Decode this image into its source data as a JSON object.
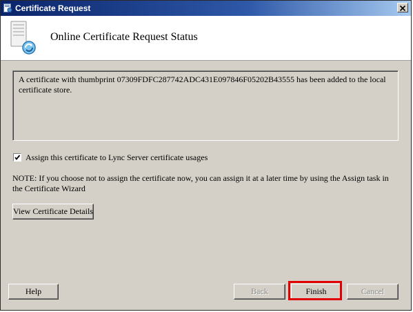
{
  "window": {
    "title": "Certificate Request",
    "icons": {
      "title": "certificate-icon",
      "close": "close-icon"
    }
  },
  "header": {
    "title": "Online Certificate Request Status",
    "icon": "server-certificate-icon"
  },
  "status": {
    "message": "A certificate with thumbprint 07309FDFC287742ADC431E097846F05202B43555 has been added to the local certificate store."
  },
  "assign_option": {
    "label": "Assign this certificate to Lync Server certificate usages",
    "checked": true
  },
  "note": "NOTE: If you choose not to assign the certificate now, you can assign it at a later time by using the Assign task in the Certificate Wizard",
  "buttons": {
    "view_details": "View Certificate Details",
    "help": "Help",
    "back": "Back",
    "finish": "Finish",
    "cancel": "Cancel"
  },
  "colors": {
    "titlebar_start": "#0a246a",
    "titlebar_end": "#a6caf0",
    "dialog_bg": "#d4d0c8",
    "highlight": "#e00000"
  }
}
